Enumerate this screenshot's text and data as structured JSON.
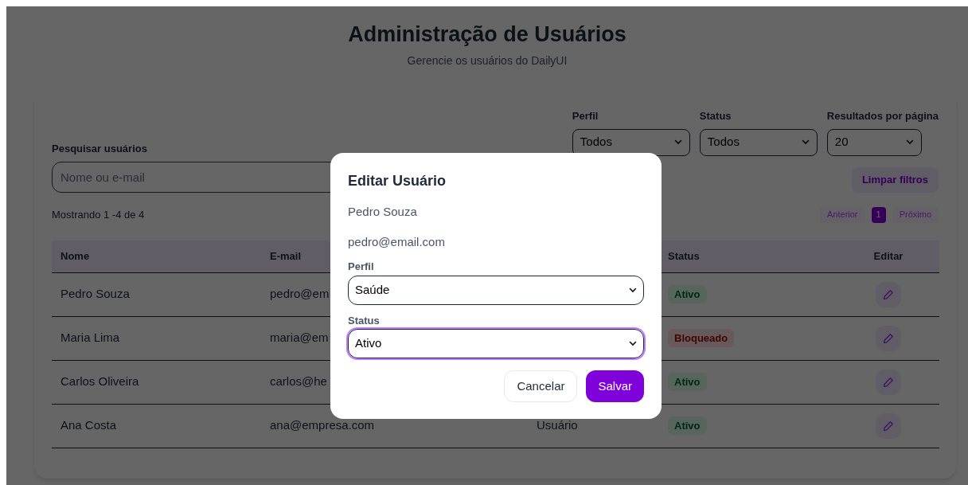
{
  "header": {
    "title": "Administração de Usuários",
    "subtitle": "Gerencie os usuários do DailyUI"
  },
  "filters": {
    "search": {
      "label": "Pesquisar usuários",
      "placeholder": "Nome ou e-mail"
    },
    "selects": [
      {
        "label": "Perfil",
        "value": "Todos"
      },
      {
        "label": "Status",
        "value": "Todos"
      },
      {
        "label": "Resultados por página",
        "value": "20"
      }
    ],
    "clear_button": "Limpar filtros"
  },
  "summary": "Mostrando 1 -4 de 4",
  "pagination": {
    "previous": "Anterior",
    "pages": [
      {
        "label": "1",
        "selected": true
      }
    ],
    "next": "Próximo"
  },
  "table": {
    "columns": {
      "name": "Nome",
      "email": "E-mail",
      "status": "Status",
      "edit": "Editar"
    },
    "rows": [
      {
        "name": "Pedro Souza",
        "email": "pedro@em",
        "status": {
          "text": "Ativo",
          "kind": "active"
        }
      },
      {
        "name": "Maria Lima",
        "email": "maria@em",
        "status": {
          "text": "Bloqueado",
          "kind": "blocked"
        }
      },
      {
        "name": "Carlos Oliveira",
        "email": "carlos@he",
        "status": {
          "text": "Ativo",
          "kind": "active"
        }
      },
      {
        "name": "Ana Costa",
        "email": "ana@empresa.com",
        "column_3": "Usuário",
        "status": {
          "text": "Ativo",
          "kind": "active"
        }
      }
    ]
  },
  "modal": {
    "title": "Editar Usuário",
    "name": "Pedro Souza",
    "email": "pedro@email.com",
    "fields": [
      {
        "label": "Perfil",
        "value": "Saúde",
        "focused": false
      },
      {
        "label": "Status",
        "value": "Ativo",
        "focused": true
      }
    ],
    "buttons": [
      {
        "label": "Cancelar",
        "kind": "secondary"
      },
      {
        "label": "Salvar",
        "kind": "primary"
      }
    ]
  }
}
